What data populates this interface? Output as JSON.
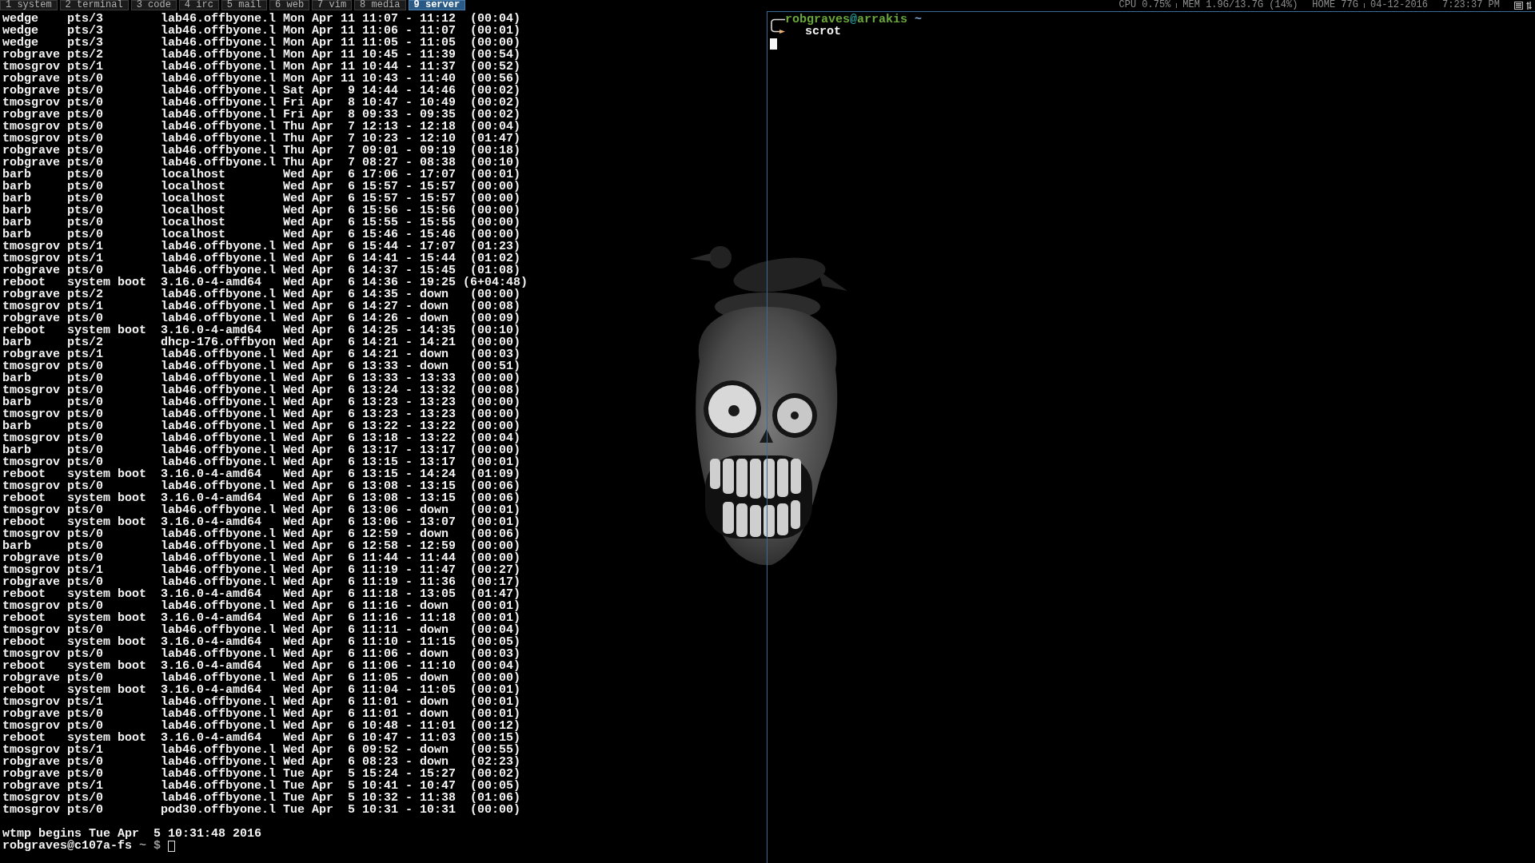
{
  "top_bar": {
    "workspaces": [
      {
        "label": "1 system",
        "selected": false
      },
      {
        "label": "2 terminal",
        "selected": false
      },
      {
        "label": "3 code",
        "selected": false
      },
      {
        "label": "4 irc",
        "selected": false
      },
      {
        "label": "5 mail",
        "selected": false
      },
      {
        "label": "6 web",
        "selected": false
      },
      {
        "label": "7 vim",
        "selected": false
      },
      {
        "label": "8 media",
        "selected": false
      },
      {
        "label": "9 server",
        "selected": true
      }
    ],
    "status_groups": [
      [
        "CPU 0.75%",
        "MEM 1.9G/13.7G (14%)"
      ],
      [
        "HOME 77G",
        "04-12-2016"
      ],
      [
        "7:23:37 PM"
      ]
    ]
  },
  "left_terminal": {
    "focused": false,
    "output": [
      "wedge    pts/3        lab46.offbyone.l Mon Apr 11 11:07 - 11:12  (00:04)",
      "wedge    pts/3        lab46.offbyone.l Mon Apr 11 11:06 - 11:07  (00:01)",
      "wedge    pts/3        lab46.offbyone.l Mon Apr 11 11:05 - 11:05  (00:00)",
      "robgrave pts/2        lab46.offbyone.l Mon Apr 11 10:45 - 11:39  (00:54)",
      "tmosgrov pts/1        lab46.offbyone.l Mon Apr 11 10:44 - 11:37  (00:52)",
      "robgrave pts/0        lab46.offbyone.l Mon Apr 11 10:43 - 11:40  (00:56)",
      "robgrave pts/0        lab46.offbyone.l Sat Apr  9 14:44 - 14:46  (00:02)",
      "tmosgrov pts/0        lab46.offbyone.l Fri Apr  8 10:47 - 10:49  (00:02)",
      "robgrave pts/0        lab46.offbyone.l Fri Apr  8 09:33 - 09:35  (00:02)",
      "tmosgrov pts/0        lab46.offbyone.l Thu Apr  7 12:13 - 12:18  (00:04)",
      "tmosgrov pts/0        lab46.offbyone.l Thu Apr  7 10:23 - 12:10  (01:47)",
      "robgrave pts/0        lab46.offbyone.l Thu Apr  7 09:01 - 09:19  (00:18)",
      "robgrave pts/0        lab46.offbyone.l Thu Apr  7 08:27 - 08:38  (00:10)",
      "barb     pts/0        localhost        Wed Apr  6 17:06 - 17:07  (00:01)",
      "barb     pts/0        localhost        Wed Apr  6 15:57 - 15:57  (00:00)",
      "barb     pts/0        localhost        Wed Apr  6 15:57 - 15:57  (00:00)",
      "barb     pts/0        localhost        Wed Apr  6 15:56 - 15:56  (00:00)",
      "barb     pts/0        localhost        Wed Apr  6 15:55 - 15:55  (00:00)",
      "barb     pts/0        localhost        Wed Apr  6 15:46 - 15:46  (00:00)",
      "tmosgrov pts/1        lab46.offbyone.l Wed Apr  6 15:44 - 17:07  (01:23)",
      "tmosgrov pts/1        lab46.offbyone.l Wed Apr  6 14:41 - 15:44  (01:02)",
      "robgrave pts/0        lab46.offbyone.l Wed Apr  6 14:37 - 15:45  (01:08)",
      "reboot   system boot  3.16.0-4-amd64   Wed Apr  6 14:36 - 19:25 (6+04:48)",
      "robgrave pts/2        lab46.offbyone.l Wed Apr  6 14:35 - down   (00:00)",
      "tmosgrov pts/1        lab46.offbyone.l Wed Apr  6 14:27 - down   (00:08)",
      "robgrave pts/0        lab46.offbyone.l Wed Apr  6 14:26 - down   (00:09)",
      "reboot   system boot  3.16.0-4-amd64   Wed Apr  6 14:25 - 14:35  (00:10)",
      "barb     pts/2        dhcp-176.offbyon Wed Apr  6 14:21 - 14:21  (00:00)",
      "robgrave pts/1        lab46.offbyone.l Wed Apr  6 14:21 - down   (00:03)",
      "tmosgrov pts/0        lab46.offbyone.l Wed Apr  6 13:33 - down   (00:51)",
      "barb     pts/0        lab46.offbyone.l Wed Apr  6 13:33 - 13:33  (00:00)",
      "tmosgrov pts/0        lab46.offbyone.l Wed Apr  6 13:24 - 13:32  (00:08)",
      "barb     pts/0        lab46.offbyone.l Wed Apr  6 13:23 - 13:23  (00:00)",
      "tmosgrov pts/0        lab46.offbyone.l Wed Apr  6 13:23 - 13:23  (00:00)",
      "barb     pts/0        lab46.offbyone.l Wed Apr  6 13:22 - 13:22  (00:00)",
      "tmosgrov pts/0        lab46.offbyone.l Wed Apr  6 13:18 - 13:22  (00:04)",
      "barb     pts/0        lab46.offbyone.l Wed Apr  6 13:17 - 13:17  (00:00)",
      "tmosgrov pts/0        lab46.offbyone.l Wed Apr  6 13:15 - 13:17  (00:01)",
      "reboot   system boot  3.16.0-4-amd64   Wed Apr  6 13:15 - 14:24  (01:09)",
      "tmosgrov pts/0        lab46.offbyone.l Wed Apr  6 13:08 - 13:15  (00:06)",
      "reboot   system boot  3.16.0-4-amd64   Wed Apr  6 13:08 - 13:15  (00:06)",
      "tmosgrov pts/0        lab46.offbyone.l Wed Apr  6 13:06 - down   (00:01)",
      "reboot   system boot  3.16.0-4-amd64   Wed Apr  6 13:06 - 13:07  (00:01)",
      "tmosgrov pts/0        lab46.offbyone.l Wed Apr  6 12:59 - down   (00:06)",
      "barb     pts/0        lab46.offbyone.l Wed Apr  6 12:58 - 12:59  (00:00)",
      "robgrave pts/0        lab46.offbyone.l Wed Apr  6 11:44 - 11:44  (00:00)",
      "tmosgrov pts/1        lab46.offbyone.l Wed Apr  6 11:19 - 11:47  (00:27)",
      "robgrave pts/0        lab46.offbyone.l Wed Apr  6 11:19 - 11:36  (00:17)",
      "reboot   system boot  3.16.0-4-amd64   Wed Apr  6 11:18 - 13:05  (01:47)",
      "tmosgrov pts/0        lab46.offbyone.l Wed Apr  6 11:16 - down   (00:01)",
      "reboot   system boot  3.16.0-4-amd64   Wed Apr  6 11:16 - 11:18  (00:01)",
      "tmosgrov pts/0        lab46.offbyone.l Wed Apr  6 11:11 - down   (00:04)",
      "reboot   system boot  3.16.0-4-amd64   Wed Apr  6 11:10 - 11:15  (00:05)",
      "tmosgrov pts/0        lab46.offbyone.l Wed Apr  6 11:06 - down   (00:03)",
      "reboot   system boot  3.16.0-4-amd64   Wed Apr  6 11:06 - 11:10  (00:04)",
      "robgrave pts/0        lab46.offbyone.l Wed Apr  6 11:05 - down   (00:00)",
      "reboot   system boot  3.16.0-4-amd64   Wed Apr  6 11:04 - 11:05  (00:01)",
      "tmosgrov pts/1        lab46.offbyone.l Wed Apr  6 11:01 - down   (00:01)",
      "robgrave pts/0        lab46.offbyone.l Wed Apr  6 11:01 - down   (00:01)",
      "tmosgrov pts/0        lab46.offbyone.l Wed Apr  6 10:48 - 11:01  (00:12)",
      "reboot   system boot  3.16.0-4-amd64   Wed Apr  6 10:47 - 11:03  (00:15)",
      "tmosgrov pts/1        lab46.offbyone.l Wed Apr  6 09:52 - down   (00:55)",
      "robgrave pts/0        lab46.offbyone.l Wed Apr  6 08:23 - down   (02:23)",
      "robgrave pts/0        lab46.offbyone.l Tue Apr  5 15:24 - 15:27  (00:02)",
      "robgrave pts/1        lab46.offbyone.l Tue Apr  5 10:41 - 10:47  (00:05)",
      "tmosgrov pts/0        lab46.offbyone.l Tue Apr  5 10:32 - 11:38  (01:06)",
      "tmosgrov pts/0        pod30.offbyone.l Tue Apr  5 10:31 - 10:31  (00:00)"
    ],
    "footer": "wtmp begins Tue Apr  5 10:31:48 2016",
    "prompt": {
      "user_host": "robgraves@c107a-fs",
      "dir": "~",
      "symbol": "$"
    }
  },
  "right_terminal": {
    "focused": true,
    "prompt": {
      "user": "robgraves",
      "at": "@",
      "host": "arrakis",
      "dir": "~"
    },
    "command": "scrot"
  }
}
